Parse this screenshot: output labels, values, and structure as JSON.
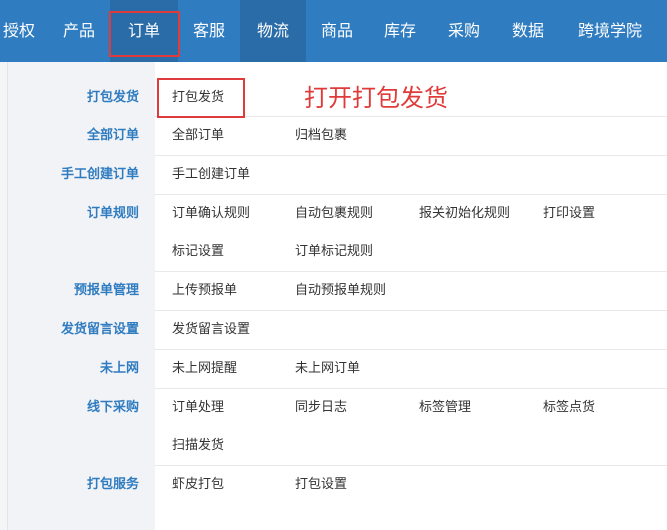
{
  "nav": {
    "items": [
      "授权",
      "产品",
      "订单",
      "客服",
      "物流",
      "商品",
      "库存",
      "采购",
      "数据",
      "跨境学院"
    ],
    "active_index": 2
  },
  "menu": {
    "categories": [
      {
        "label": "打包发货",
        "items": [
          "打包发货"
        ]
      },
      {
        "label": "全部订单",
        "items": [
          "全部订单",
          "归档包裹"
        ]
      },
      {
        "label": "手工创建订单",
        "items": [
          "手工创建订单"
        ]
      },
      {
        "label": "订单规则",
        "items": [
          "订单确认规则",
          "自动包裹规则",
          "报关初始化规则",
          "打印设置",
          "标记设置",
          "订单标记规则"
        ]
      },
      {
        "label": "预报单管理",
        "items": [
          "上传预报单",
          "自动预报单规则"
        ]
      },
      {
        "label": "发货留言设置",
        "items": [
          "发货留言设置"
        ]
      },
      {
        "label": "未上网",
        "items": [
          "未上网提醒",
          "未上网订单"
        ]
      },
      {
        "label": "线下采购",
        "items": [
          "订单处理",
          "同步日志",
          "标签管理",
          "标签点货",
          "扫描发货"
        ]
      },
      {
        "label": "打包服务",
        "items": [
          "虾皮打包",
          "打包设置"
        ]
      }
    ]
  },
  "annotation": "打开打包发货",
  "colors": {
    "nav_bg": "#2f7cc0",
    "nav_active": "#2a6ca8",
    "category_text": "#2f7cc0",
    "highlight": "#e03b3b"
  }
}
